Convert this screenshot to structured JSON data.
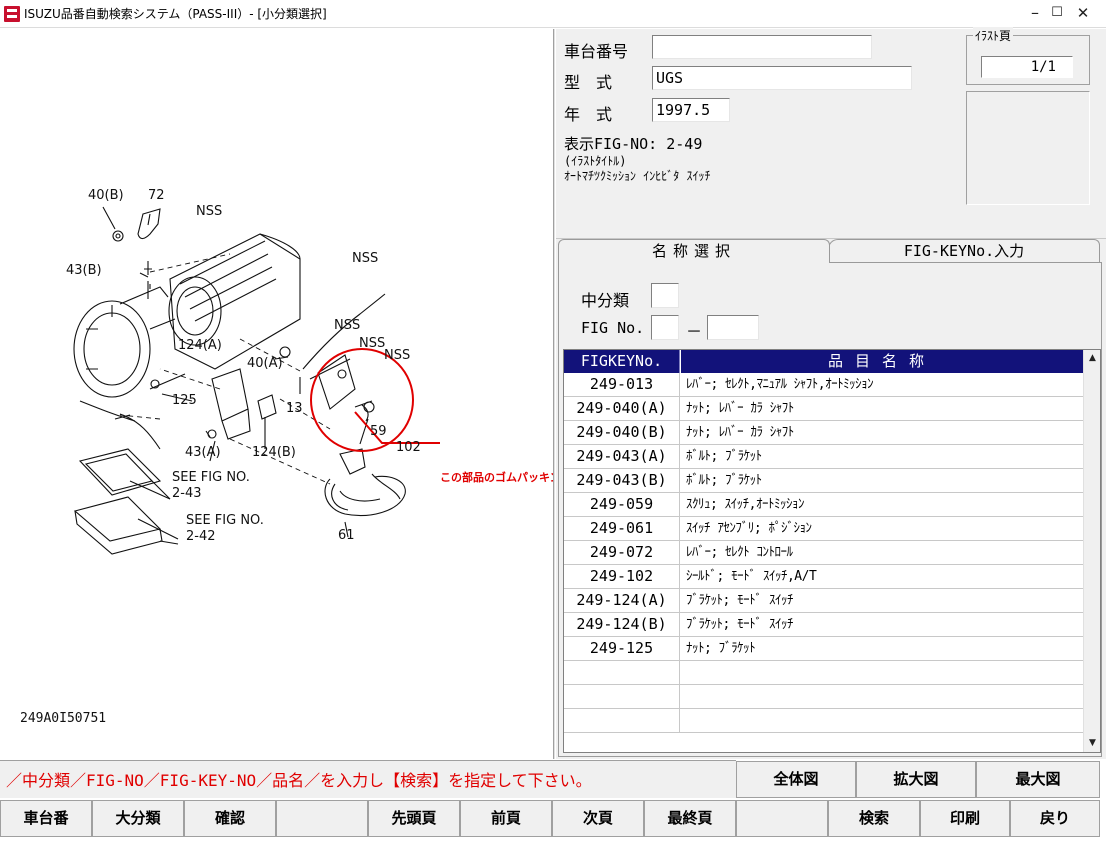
{
  "window": {
    "title": "ISUZU品番自動検索システム（PASS-III）- [小分類選択]",
    "minimize": "–",
    "maximize": "☐",
    "close": "✕"
  },
  "diagram": {
    "labels": [
      "40(B)",
      "72",
      "NSS",
      "43(B)",
      "NSS",
      "124(A)",
      "40(A)",
      "NSS",
      "NSS",
      "NSS",
      "125",
      "13",
      "59",
      "102",
      "43(A)",
      "124(B)",
      "SEE FIG NO.",
      "2-43",
      "SEE FIG NO.",
      "2-42",
      "61"
    ],
    "callout": "この部品のゴムパッキンが必要",
    "code": "249A0I50751",
    "accent_color": "#e00000"
  },
  "info": {
    "chassis_label": "車台番号",
    "chassis_value": "",
    "model_label": "型　式",
    "model_value": "UGS",
    "year_label": "年　式",
    "year_value": "1997.5",
    "fig_no_text": "表示FIG-NO: 2-49",
    "illust_title_label": "(ｲﾗｽﾄﾀｲﾄﾙ)",
    "illust_title": "ｵｰﾄﾏﾁﾂｸﾐｯｼｮﾝ ｲﾝﾋﾋﾞﾀ ｽｲｯﾁ",
    "illust_page_label": "ｲﾗｽﾄ頁",
    "illust_page_value": "1/1"
  },
  "tabs": {
    "name_select": "名称選択",
    "fig_key_input": "FIG-KEYNo.入力"
  },
  "search": {
    "middle_category_label": "中分類",
    "fig_no_label": "FIG No.",
    "fig_no_separator": "－"
  },
  "table": {
    "headers": {
      "key": "FIGKEYNo.",
      "name": "品目名称"
    },
    "rows": [
      {
        "key": "249-013",
        "name": "ﾚﾊﾞｰ; ｾﾚｸﾄ,ﾏﾆｭｱﾙ ｼｬﾌﾄ,ｵｰﾄﾐｯｼｮﾝ"
      },
      {
        "key": "249-040(A)",
        "name": "ﾅｯﾄ; ﾚﾊﾞｰ ｶﾗ ｼｬﾌﾄ"
      },
      {
        "key": "249-040(B)",
        "name": "ﾅｯﾄ; ﾚﾊﾞｰ ｶﾗ ｼｬﾌﾄ"
      },
      {
        "key": "249-043(A)",
        "name": "ﾎﾞﾙﾄ; ﾌﾞﾗｹｯﾄ"
      },
      {
        "key": "249-043(B)",
        "name": "ﾎﾞﾙﾄ; ﾌﾞﾗｹｯﾄ"
      },
      {
        "key": "249-059",
        "name": "ｽｸﾘｭ; ｽｲｯﾁ,ｵｰﾄﾐｯｼｮﾝ"
      },
      {
        "key": "249-061",
        "name": "ｽｲｯﾁ ｱｾﾝﾌﾞﾘ; ﾎﾟｼﾞｼｮﾝ"
      },
      {
        "key": "249-072",
        "name": "ﾚﾊﾞｰ; ｾﾚｸﾄ ｺﾝﾄﾛｰﾙ"
      },
      {
        "key": "249-102",
        "name": "ｼｰﾙﾄﾞ; ﾓｰﾄﾞ ｽｲｯﾁ,A/T"
      },
      {
        "key": "249-124(A)",
        "name": "ﾌﾞﾗｹｯﾄ; ﾓｰﾄﾞ ｽｲｯﾁ"
      },
      {
        "key": "249-124(B)",
        "name": "ﾌﾞﾗｹｯﾄ; ﾓｰﾄﾞ ｽｲｯﾁ"
      },
      {
        "key": "249-125",
        "name": "ﾅｯﾄ; ﾌﾞﾗｹｯﾄ"
      },
      {
        "key": "",
        "name": ""
      },
      {
        "key": "",
        "name": ""
      },
      {
        "key": "",
        "name": ""
      }
    ]
  },
  "message": "／中分類／FIG-NO／FIG-KEY-NO／品名／を入力し【検索】を指定して下さい。",
  "view_buttons": {
    "full": "全体図",
    "zoom": "拡大図",
    "max": "最大図"
  },
  "nav_buttons": {
    "chassis": "車台番",
    "major": "大分類",
    "confirm": "確認",
    "blank1": "",
    "first": "先頭頁",
    "prev": "前頁",
    "next": "次頁",
    "last": "最終頁",
    "blank2": "",
    "search": "検索",
    "print": "印刷",
    "back": "戻り"
  }
}
